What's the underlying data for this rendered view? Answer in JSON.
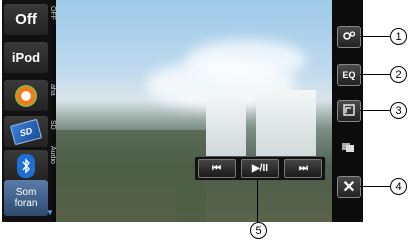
{
  "sources": {
    "off_label": "Off",
    "ipod_label": "iPod",
    "aha_side": "aha",
    "sd_label": "SD",
    "sd_side": "SD",
    "audio_side": "Audio",
    "bt_icon": "bluetooth-icon",
    "som_label_1": "Som",
    "som_label_2": "foran"
  },
  "off_side": "OFF",
  "controls": {
    "prev": "⏮",
    "play_pause": "▶/II",
    "next": "⏭"
  },
  "right": {
    "eq_label": "EQ",
    "close_label": "✕"
  },
  "callouts": [
    "1",
    "2",
    "3",
    "4",
    "5"
  ]
}
